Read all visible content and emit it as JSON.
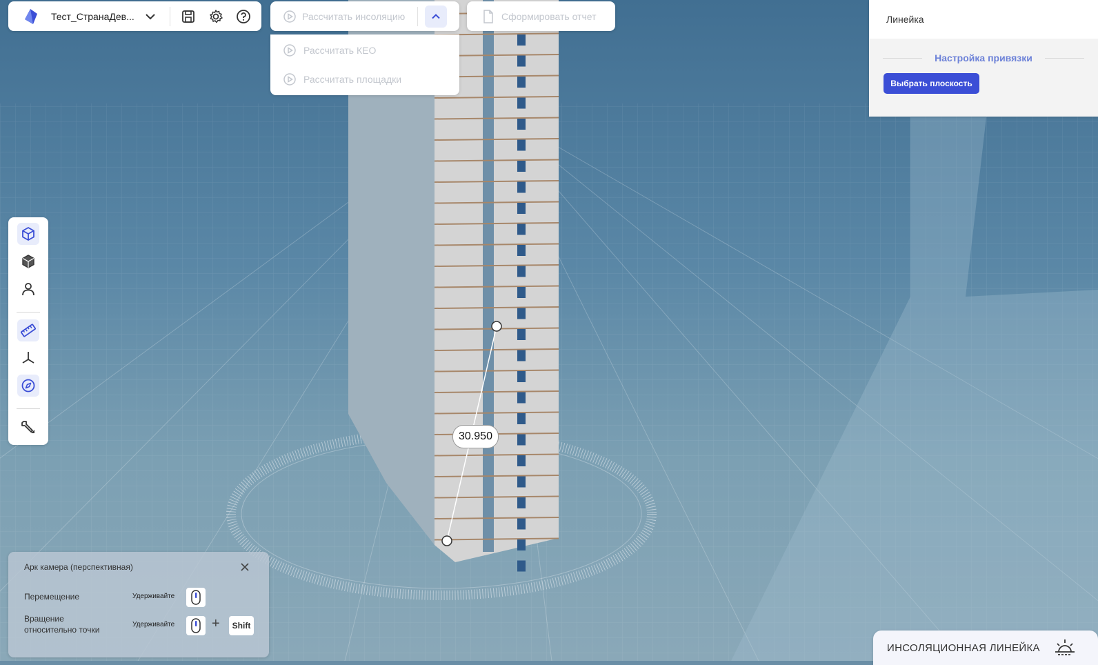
{
  "project": {
    "name": "Тест_СтранаДев...",
    "icons": [
      "app-logo-icon",
      "chevron-down-icon",
      "save-icon",
      "settings-icon",
      "help-icon"
    ]
  },
  "calculations": {
    "main_label": "Рассчитать инсоляцию",
    "menu_items": [
      "Рассчитать КЕО",
      "Рассчитать площадки"
    ],
    "report_label": "Сформировать отчет"
  },
  "ruler_panel": {
    "title": "Линейка",
    "section_title": "Настройка привязки",
    "select_plane_button": "Выбрать плоскость"
  },
  "toolbar": {
    "tools": [
      "view-cube-icon",
      "solid-cube-icon",
      "person-icon",
      "ruler-icon",
      "axes-icon",
      "compass-icon",
      "settings-tool-icon"
    ],
    "active": [
      "view-cube-icon",
      "ruler-icon",
      "compass-icon"
    ]
  },
  "camera_panel": {
    "title": "Арк камера (перспективная)",
    "move_label": "Перемещение",
    "hold_label_1": "Удерживайте",
    "rotate_label_1": "Вращение",
    "rotate_label_2": "относительно точки",
    "hold_label_2": "Удерживайте",
    "plus": "+",
    "shift_key": "Shift"
  },
  "insolation_button": {
    "label": "ИНСОЛЯЦИОННАЯ ЛИНЕЙКА"
  },
  "measurement": {
    "value": "30.950"
  },
  "colors": {
    "accent": "#3b4ed6",
    "accent_light": "#e8ecfb",
    "section_title": "#6d82d8",
    "disabled_text": "#c3c7ce"
  }
}
